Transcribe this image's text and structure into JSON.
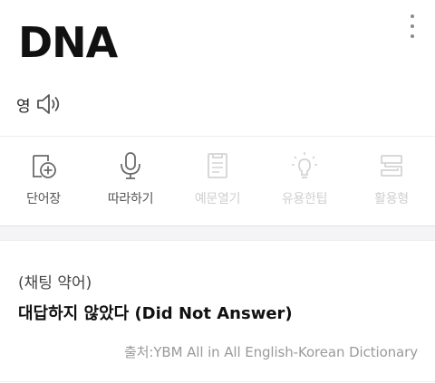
{
  "entry": {
    "word": "DNA",
    "pronunciation_label": "영"
  },
  "toolbar": {
    "items": [
      {
        "label": "단어장",
        "icon": "add-to-wordbook-icon",
        "enabled": true
      },
      {
        "label": "따라하기",
        "icon": "microphone-icon",
        "enabled": true
      },
      {
        "label": "예문열기",
        "icon": "document-icon",
        "enabled": false
      },
      {
        "label": "유용한팁",
        "icon": "lightbulb-icon",
        "enabled": false
      },
      {
        "label": "활용형",
        "icon": "forms-icon",
        "enabled": false
      }
    ]
  },
  "definition": {
    "category": "(채팅 약어)",
    "meaning": "대답하지 않았다 (Did Not Answer)",
    "source": "출처:YBM All in All English-Korean Dictionary"
  },
  "colors": {
    "icon_enabled": "#6b6b6b",
    "icon_disabled": "#d4d4d4",
    "band": "#f4f4f6"
  }
}
